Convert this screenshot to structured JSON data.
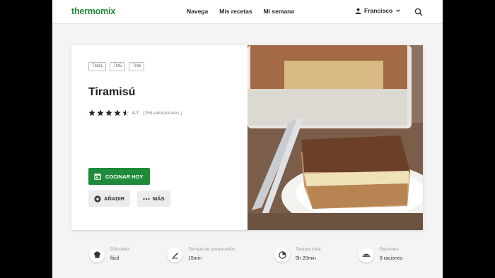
{
  "header": {
    "logo": "thermomix",
    "nav": [
      "Navega",
      "Mis recetas",
      "Mi semana"
    ],
    "user": "Francisco"
  },
  "recipe": {
    "tags": [
      "TM31",
      "TM5",
      "TM6"
    ],
    "title": "Tiramisú",
    "rating_value": "4.7",
    "rating_count": "(256 valoraciones )",
    "rating": 4.7,
    "cook_label": "COCINAR HOY",
    "add_label": "AÑADIR",
    "more_label": "MÁS"
  },
  "info": {
    "difficulty_label": "Dificultad",
    "difficulty_value": "fácil",
    "prep_label": "Tiempo de preparación",
    "prep_value": "15min",
    "total_label": "Tiempo total",
    "total_value": "5h 20min",
    "servings_label": "Raciones",
    "servings_value": "8 raciones"
  },
  "colors": {
    "brand": "#1f8a3a"
  }
}
